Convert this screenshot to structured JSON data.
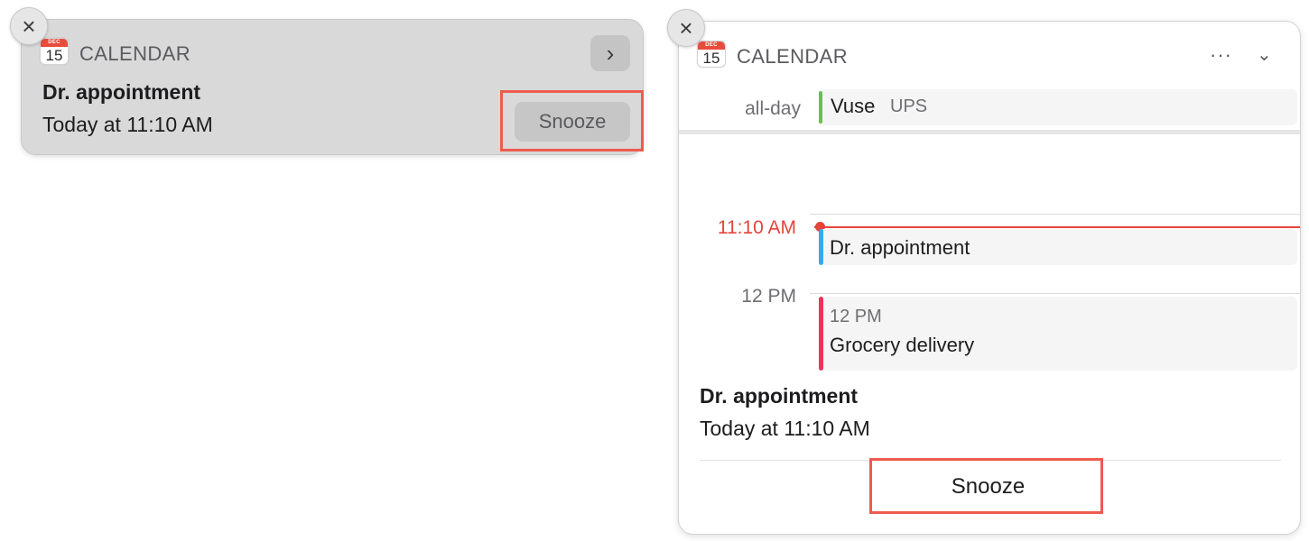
{
  "compact": {
    "app_icon": {
      "name": "calendar-app-icon",
      "month": "DEC",
      "day": "15"
    },
    "app_name": "CALENDAR",
    "close_glyph": "×",
    "expand_glyph": "›",
    "event_title": "Dr. appointment",
    "event_time": "Today at 11:10 AM",
    "snooze_label": "Snooze"
  },
  "expanded": {
    "app_icon": {
      "name": "calendar-app-icon",
      "month": "DEC",
      "day": "15"
    },
    "app_name": "CALENDAR",
    "close_glyph": "×",
    "more_glyph": "···",
    "collapse_glyph": "⌄",
    "all_day": {
      "label": "all-day",
      "event_title": "Vuse",
      "event_subtitle": "UPS",
      "color": "#67c04f"
    },
    "timeline": {
      "current_time_label": "11:10 AM",
      "hour_label": "12 PM",
      "now_color": "#e5443a",
      "events": [
        {
          "title": "Dr. appointment",
          "time": "",
          "color": "#36a9f1"
        },
        {
          "title": "Grocery delivery",
          "time": "12 PM",
          "color": "#f0325a"
        }
      ]
    },
    "event_title": "Dr. appointment",
    "event_time": "Today at 11:10 AM",
    "snooze_label": "Snooze"
  },
  "highlight_color": "#ec5b4f"
}
